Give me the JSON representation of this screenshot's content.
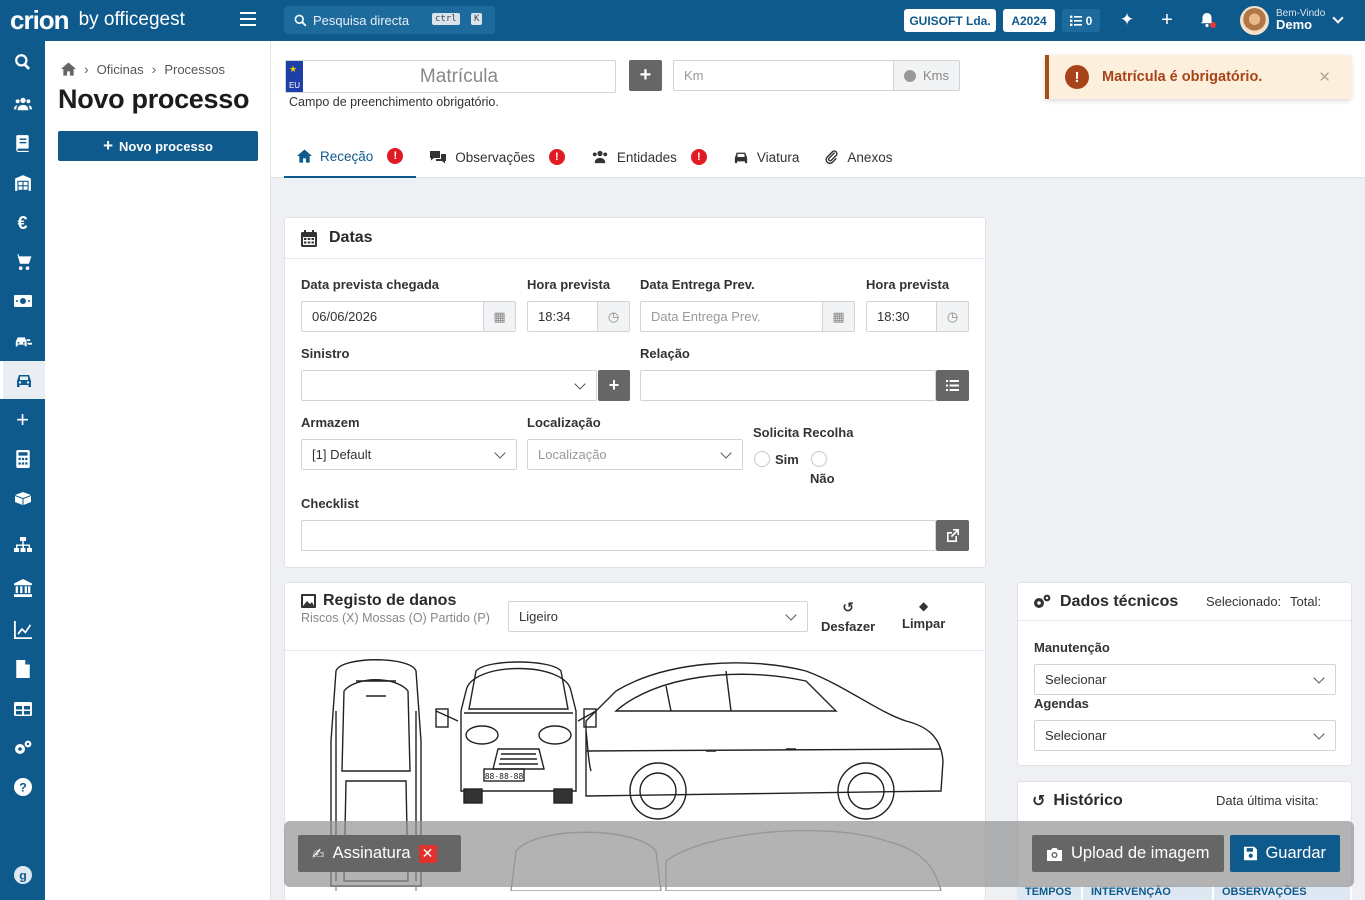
{
  "topbar": {
    "brand": "crion",
    "brand_suffix": "by officegest",
    "search_placeholder": "Pesquisa directa",
    "shortcut_key1": "ctrl",
    "shortcut_key2": "K",
    "company_badge": "GUISOFT Lda.",
    "year_badge": "A2024",
    "tasks_count": "0",
    "welcome_small": "Bem-Vindo",
    "user_name": "Demo"
  },
  "sidebar": {
    "icons": [
      "search-icon",
      "users-icon",
      "book-icon",
      "warehouse-icon",
      "euro-icon",
      "cart-icon",
      "money-icon",
      "car-wash-icon",
      "car-icon",
      "plus-icon",
      "calculator-icon",
      "boxes-icon",
      "sitemap-icon",
      "bank-icon",
      "chart-icon",
      "file-icon",
      "table-icon",
      "cogs-icon",
      "help-icon",
      "g-logo-icon"
    ],
    "active_icon": "car-icon"
  },
  "left_panel": {
    "breadcrumb": [
      "Oficinas",
      "Processos"
    ],
    "title": "Novo processo",
    "new_button": "Novo processo"
  },
  "header": {
    "plate_placeholder": "Matrícula",
    "plate_country": "EU",
    "plate_hint": "Campo de preenchimento obrigatório.",
    "km_placeholder": "Km",
    "km_unit": "Kms",
    "tabs": [
      {
        "label": "Receção",
        "icon": "home-icon",
        "warning": true,
        "active": true
      },
      {
        "label": "Observações",
        "icon": "comments-icon",
        "warning": true,
        "active": false
      },
      {
        "label": "Entidades",
        "icon": "users-icon",
        "warning": true,
        "active": false
      },
      {
        "label": "Viatura",
        "icon": "car-icon",
        "warning": false,
        "active": false
      },
      {
        "label": "Anexos",
        "icon": "paperclip-icon",
        "warning": false,
        "active": false
      }
    ]
  },
  "toast": {
    "message": "Matrícula é obrigatório."
  },
  "datas": {
    "title": "Datas",
    "arrival_date_label": "Data prevista chegada",
    "arrival_date_value": "06/06/2026",
    "arrival_time_label": "Hora prevista",
    "arrival_time_value": "18:34",
    "delivery_date_label": "Data Entrega Prev.",
    "delivery_date_placeholder": "Data Entrega Prev.",
    "delivery_time_label": "Hora prevista",
    "delivery_time_value": "18:30",
    "sinistro_label": "Sinistro",
    "relacao_label": "Relação",
    "armazem_label": "Armazem",
    "armazem_value": "[1] Default",
    "localizacao_label": "Localização",
    "localizacao_placeholder": "Localização",
    "recolha_label": "Solicita Recolha",
    "recolha_yes": "Sim",
    "recolha_no": "Não",
    "checklist_label": "Checklist"
  },
  "danos": {
    "title": "Registo de danos",
    "legend": "Riscos (X)  Mossas (O)  Partido (P)",
    "vehicle_type": "Ligeiro",
    "undo": "Desfazer",
    "clear": "Limpar",
    "plate_text": "88-88-88"
  },
  "tecnicos": {
    "title": "Dados técnicos",
    "selected_label": "Selecionado:",
    "total_label": "Total:",
    "manutencao_label": "Manutenção",
    "manutencao_value": "Selecionar",
    "agendas_label": "Agendas",
    "agendas_value": "Selecionar"
  },
  "historico": {
    "title": "Histórico",
    "last_visit_label": "Data última visita:",
    "columns": [
      "TEMPOS",
      "INTERVENÇÃO",
      "OBSERVAÇÕES"
    ]
  },
  "bottom_bar": {
    "signature": "Assinatura",
    "upload": "Upload de imagem",
    "save": "Guardar"
  }
}
